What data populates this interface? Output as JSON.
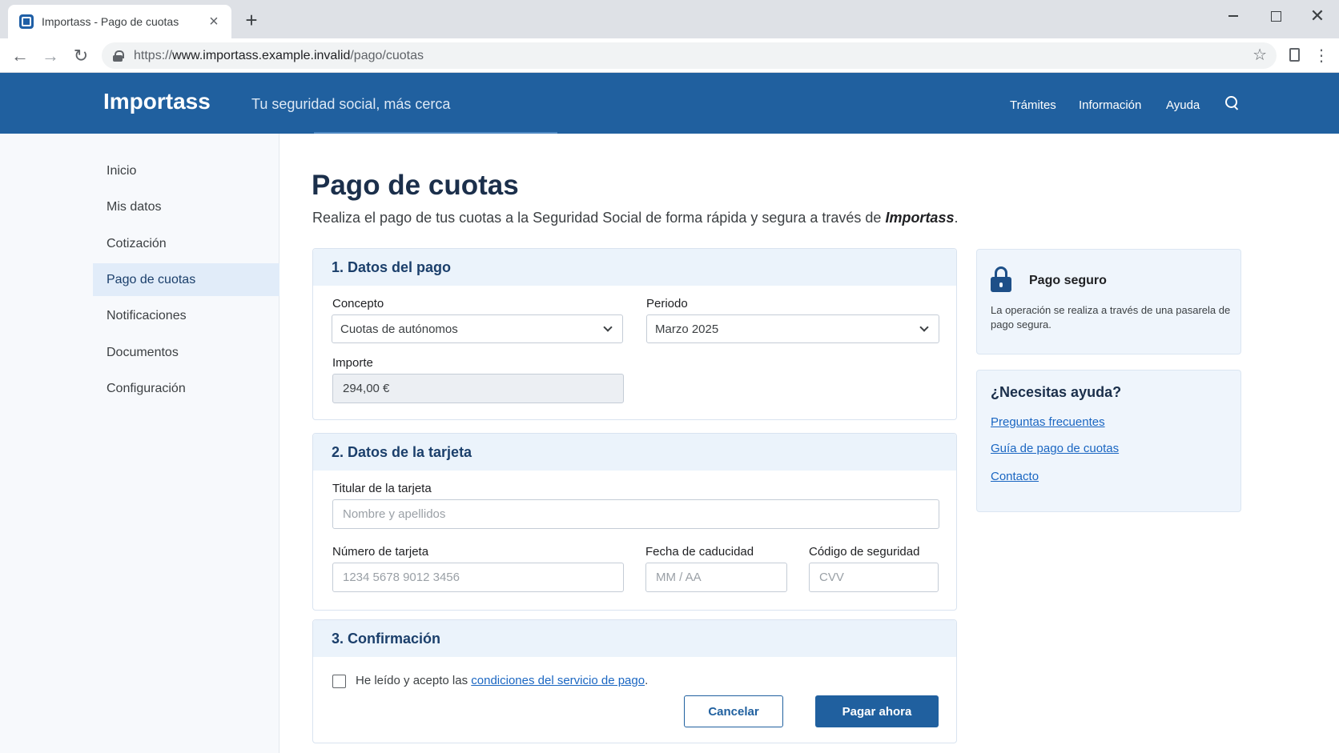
{
  "browser": {
    "tab_title": "Importass - Pago de cuotas",
    "url_scheme": "https://",
    "url_host": "www.importass.example.invalid",
    "url_path": "/pago/cuotas"
  },
  "header": {
    "brand": "Importass",
    "tagline": "Tu seguridad social, más cerca",
    "nav": [
      "Trámites",
      "Información",
      "Ayuda"
    ]
  },
  "sidebar": {
    "items": [
      {
        "label": "Inicio",
        "active": false
      },
      {
        "label": "Mis datos",
        "active": false
      },
      {
        "label": "Cotización",
        "active": false
      },
      {
        "label": "Pago de cuotas",
        "active": true
      },
      {
        "label": "Notificaciones",
        "active": false
      },
      {
        "label": "Documentos",
        "active": false
      },
      {
        "label": "Configuración",
        "active": false
      }
    ]
  },
  "main": {
    "title": "Pago de cuotas",
    "description_prefix": "Realiza el pago de tus cuotas a la Seguridad Social de forma rápida y segura a través de ",
    "description_brand": "Importass",
    "description_suffix": "."
  },
  "payment": {
    "heading": "1. Datos del pago",
    "concepto_label": "Concepto",
    "concepto_value": "Cuotas de autónomos",
    "periodo_label": "Periodo",
    "periodo_value": "Marzo 2025",
    "importe_label": "Importe",
    "importe_value": "294,00 €"
  },
  "card": {
    "heading": "2. Datos de la tarjeta",
    "holder_label": "Titular de la tarjeta",
    "holder_placeholder": "Nombre y apellidos",
    "number_label": "Número de tarjeta",
    "number_placeholder": "1234 5678 9012 3456",
    "expiry_label": "Fecha de caducidad",
    "expiry_placeholder": "MM / AA",
    "cvv_label": "Código de seguridad",
    "cvv_placeholder": "CVV"
  },
  "confirm": {
    "heading": "3. Confirmación",
    "checkbox_prefix": "He leído y acepto las ",
    "checkbox_link": "condiciones del servicio de pago",
    "checkbox_suffix": ".",
    "checked": false,
    "cancel_label": "Cancelar",
    "pay_label": "Pagar ahora"
  },
  "secure": {
    "title": "Pago seguro",
    "text": "La operación se realiza a través de una pasarela de pago segura."
  },
  "help": {
    "title": "¿Necesitas ayuda?",
    "links": [
      "Preguntas frecuentes",
      "Guía de pago de cuotas",
      "Contacto"
    ]
  },
  "colors": {
    "brand_blue": "#20609f",
    "link_blue": "#1a66c2",
    "panel_header_bg": "#ebf3fb"
  }
}
